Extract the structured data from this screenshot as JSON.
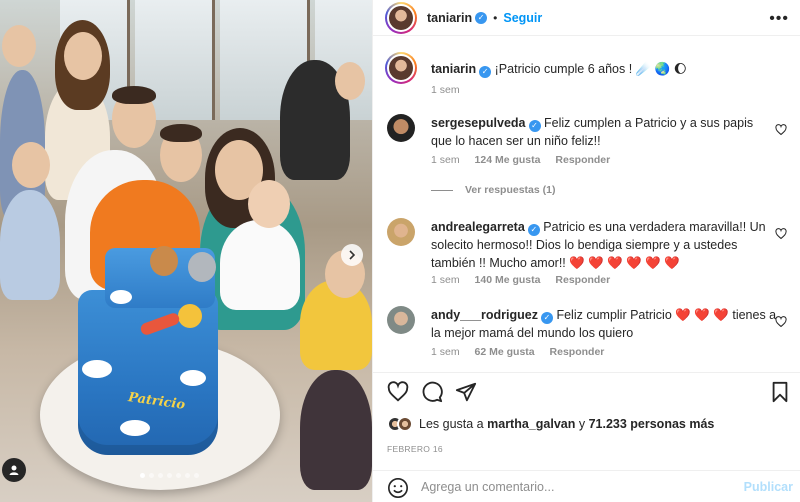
{
  "media": {
    "carousel_dots": 7,
    "active_dot": 0,
    "cake_text": "Patricio"
  },
  "post": {
    "username": "taniarin",
    "follow_label": "Seguir",
    "caption": "¡Patricio cumple 6 años ! ☄️ 🌏 🌔",
    "caption_time": "1 sem"
  },
  "comments": [
    {
      "username": "sergesepulveda",
      "text": "Feliz cumplen a Patricio y a sus papis que lo hacen ser un niño feliz!!",
      "time": "1 sem",
      "likes": "124 Me gusta",
      "reply": "Responder",
      "view_replies": "Ver respuestas (1)"
    },
    {
      "username": "andrealegarreta",
      "text": "Patricio es una verdadera maravilla!! Un solecito hermoso!! Dios lo bendiga siempre y a ustedes también !! Mucho amor!! ❤️ ❤️ ❤️ ❤️ ❤️ ❤️",
      "time": "1 sem",
      "likes": "140 Me gusta",
      "reply": "Responder"
    },
    {
      "username": "andy___rodriguez",
      "text": "Feliz cumplir Patricio ❤️ ❤️ ❤️ tienes a la mejor mamá del mundo los quiero",
      "time": "1 sem",
      "likes": "62 Me gusta",
      "reply": "Responder"
    }
  ],
  "likes": {
    "prefix": "Les gusta a",
    "user": "martha_galvan",
    "middle": "y",
    "count": "71.233 personas más"
  },
  "date": "FEBRERO 16",
  "compose": {
    "placeholder": "Agrega un comentario...",
    "publish": "Publicar"
  },
  "colors": {
    "link": "#0095f6",
    "text": "#262626",
    "muted": "#8e8e8e",
    "publish_disabled": "#b2dffc"
  }
}
